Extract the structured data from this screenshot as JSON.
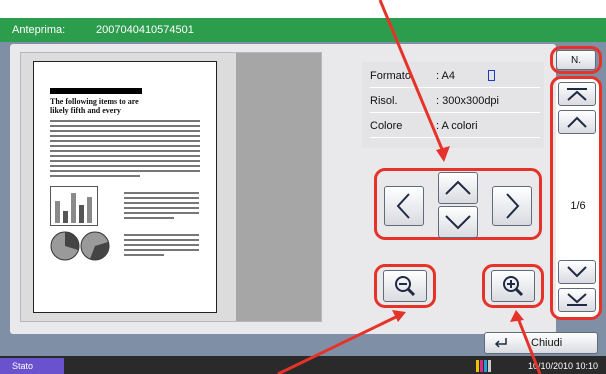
{
  "titlebar": {
    "label": "Anteprima:",
    "file_id": "2007040410574501"
  },
  "info": [
    {
      "key": "Formato",
      "value": ": A4"
    },
    {
      "key": "Risol.",
      "value": ": 300x300dpi"
    },
    {
      "key": "Colore",
      "value": ": A colori"
    }
  ],
  "document": {
    "headline_line1": "The following items to are",
    "headline_line2": "likely fifth and every"
  },
  "nav_buttons": {
    "left": "chevron-left-icon",
    "up": "chevron-up-icon",
    "down": "chevron-down-icon",
    "right": "chevron-right-icon"
  },
  "zoom": {
    "out": "zoom-out-icon",
    "in": "zoom-in-icon"
  },
  "page_nav": {
    "n_label": "N.",
    "page_indicator": "1/6"
  },
  "close_button": {
    "label": "Chiudi"
  },
  "status_bar": {
    "stato": "Stato",
    "datetime": "10/10/2010  10:10"
  },
  "colors": {
    "title_green": "#2c9d4c",
    "highlight_red": "#e5332a",
    "stato_purple": "#6a52cf",
    "screen_bg": "#7f8fa5"
  }
}
